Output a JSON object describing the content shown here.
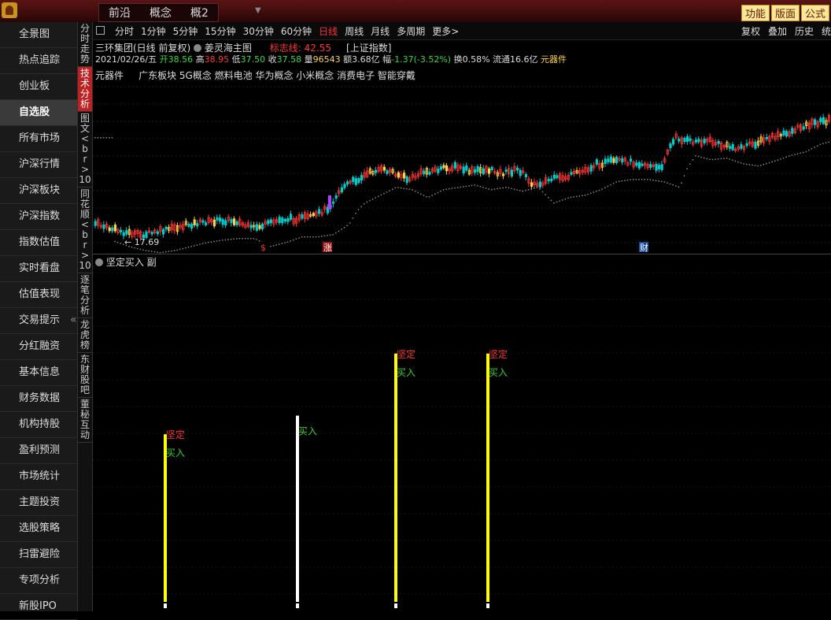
{
  "topbar": {
    "tabs": [
      "前沿",
      "概念",
      "概2"
    ],
    "right_buttons": [
      "功能",
      "版面",
      "公式"
    ]
  },
  "sidebar": {
    "items": [
      "全景图",
      "热点追踪",
      "创业板",
      "自选股",
      "所有市场",
      "沪深行情",
      "沪深板块",
      "沪深指数",
      "指数估值",
      "实时看盘",
      "估值表现",
      "交易提示",
      "分红融资",
      "基本信息",
      "财务数据",
      "机构持股",
      "盈利预测",
      "市场统计",
      "主题投资",
      "选股策略",
      "扫雷避险",
      "专项分析",
      "新股IPO"
    ],
    "active_index": 3,
    "collapse_label": "«"
  },
  "vtabs": [
    {
      "label": "分时走势",
      "active": false
    },
    {
      "label": "技术分析",
      "active": true
    },
    {
      "label": "图文10",
      "active": false
    },
    {
      "label": "同花顺10",
      "active": false
    },
    {
      "label": "逐笔分析",
      "active": false
    },
    {
      "label": "龙虎榜",
      "active": false
    },
    {
      "label": "东财股吧",
      "active": false
    },
    {
      "label": "董秘互动",
      "active": false
    }
  ],
  "toolbar": {
    "periods": [
      "分时",
      "1分钟",
      "5分钟",
      "15分钟",
      "30分钟",
      "60分钟",
      "日线",
      "周线",
      "月线",
      "多周期",
      "更多>"
    ],
    "active_period": "日线",
    "right": [
      "复权",
      "叠加",
      "历史",
      "统"
    ]
  },
  "stock": {
    "title": "三环集团(日线 前复权)",
    "indicator_name": "姜灵海主图",
    "mark_label": "标志线: 42.55",
    "index_link": "[上证指数]",
    "date": "2021/02/26/五",
    "open_label": "开",
    "open": "38.56",
    "high_label": "高",
    "high": "38.95",
    "low_label": "低",
    "low": "37.50",
    "close_label": "收",
    "close": "37.58",
    "vol_label": "量",
    "vol": "96543",
    "amount_label": "额",
    "amount": "3.68亿",
    "change_label": "幅",
    "change": "-1.37(-3.52%)",
    "turnover_label": "换",
    "turnover": "0.58%",
    "float_label": "流通",
    "float": "16.6亿",
    "sector_tag": "元器件",
    "concepts_prefix": "元器件",
    "concepts": "广东板块  5G概念 燃料电池 华为概念 小米概念 消费电子 智能穿戴"
  },
  "main_chart": {
    "low_marker": "17.69",
    "badges": [
      {
        "text": "$",
        "color": "#ff3030",
        "bg": "#000000"
      },
      {
        "text": "涨",
        "color": "#ffffff",
        "bg": "#a01010"
      },
      {
        "text": "财",
        "color": "#ffffff",
        "bg": "#1a4aa0"
      }
    ],
    "colors": {
      "up": "#ff3333",
      "down": "#00cccc",
      "yellow": "#ffd24a",
      "ma": "#888888",
      "purple": "#b040ff"
    }
  },
  "sub_chart": {
    "title": "坚定买入 副",
    "signals": [
      {
        "color": "#ffff00",
        "top_label": "坚定",
        "bottom_label": "买入",
        "value": 0.54
      },
      {
        "color": "#ffffff",
        "top_label": "",
        "bottom_label": "买入",
        "value": 0.6
      },
      {
        "color": "#ffff00",
        "top_label": "坚定",
        "bottom_label": "买入",
        "value": 0.8
      },
      {
        "color": "#ffff00",
        "top_label": "坚定",
        "bottom_label": "买入",
        "value": 0.8
      }
    ]
  }
}
